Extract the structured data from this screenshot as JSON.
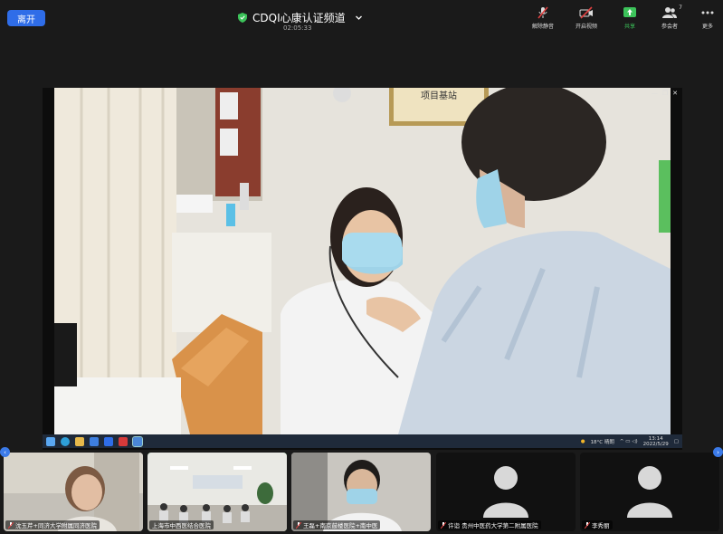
{
  "leave_label": "离开",
  "meeting": {
    "title": "CDQI心康认证频道",
    "elapsed": "02:05:33"
  },
  "toolbar": {
    "unmute_label": "解除静音",
    "start_video_label": "开启视频",
    "share_label": "共享",
    "participants_label": "参会者",
    "participants_count": "7",
    "more_label": "更多"
  },
  "shared_screen": {
    "taskbar": {
      "weather": "18°C 晴朗",
      "time": "13:14",
      "date": "2022/5/29"
    }
  },
  "participants": [
    {
      "name": "沈玉芹+同济大学附属同济医院",
      "muted": true
    },
    {
      "name": "上海市中西医结合医院",
      "muted": false
    },
    {
      "name": "王磊+南京鼓楼医院+南中医",
      "muted": true
    },
    {
      "name": "许诣 贵州中医药大学第二附属医院",
      "muted": true
    },
    {
      "name": "李秀丽",
      "muted": true
    }
  ],
  "colors": {
    "accent": "#2f6de8",
    "share_green": "#3cc35a",
    "mute_red": "#e04040",
    "active_outline": "#3cc35a"
  }
}
